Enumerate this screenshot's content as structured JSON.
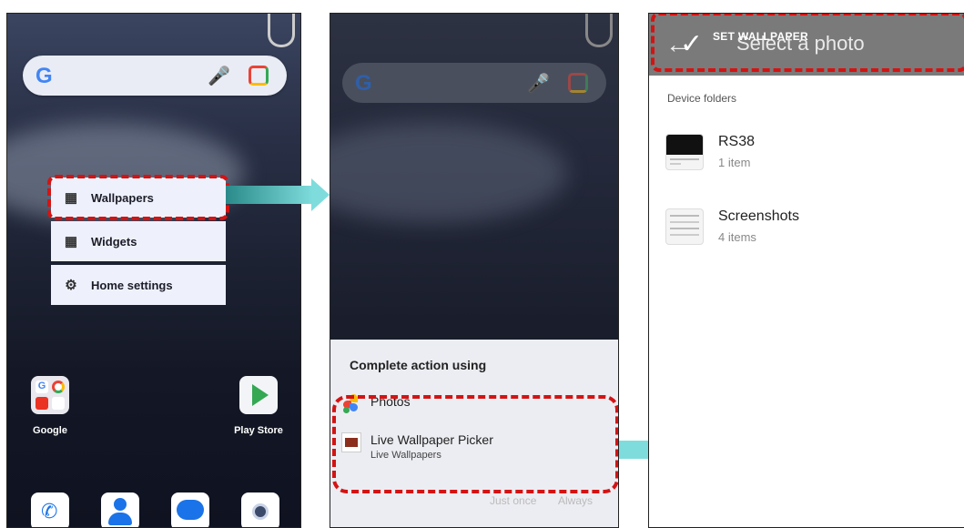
{
  "home": {
    "search_g": "G",
    "menu": [
      {
        "label": "Wallpapers",
        "icon": "wallpaper-icon"
      },
      {
        "label": "Widgets",
        "icon": "widgets-icon"
      },
      {
        "label": "Home settings",
        "icon": "gear-icon"
      }
    ],
    "apps": [
      {
        "label": "Google",
        "icon": "google-folder-icon"
      },
      {
        "label": "Play Store",
        "icon": "play-store-icon"
      }
    ],
    "dock": [
      "phone-icon",
      "contacts-icon",
      "messages-icon",
      "camera-icon"
    ]
  },
  "chooser": {
    "search_g": "G",
    "title": "Complete action using",
    "options": [
      {
        "label": "Photos",
        "sublabel": "",
        "icon": "photos-icon"
      },
      {
        "label": "Live Wallpaper Picker",
        "sublabel": "Live Wallpapers",
        "icon": "live-wallpaper-icon"
      }
    ],
    "just_once": "Just once",
    "always": "Always"
  },
  "picker": {
    "action": "SET WALLPAPER",
    "title": "Select a photo",
    "section": "Device folders",
    "folders": [
      {
        "name": "RS38",
        "count": "1 item"
      },
      {
        "name": "Screenshots",
        "count": "4 items"
      }
    ]
  },
  "colors": {
    "highlight": "#d41313",
    "arrow": "#7fdcdc",
    "arrow_dark": "#2a8a8a"
  }
}
